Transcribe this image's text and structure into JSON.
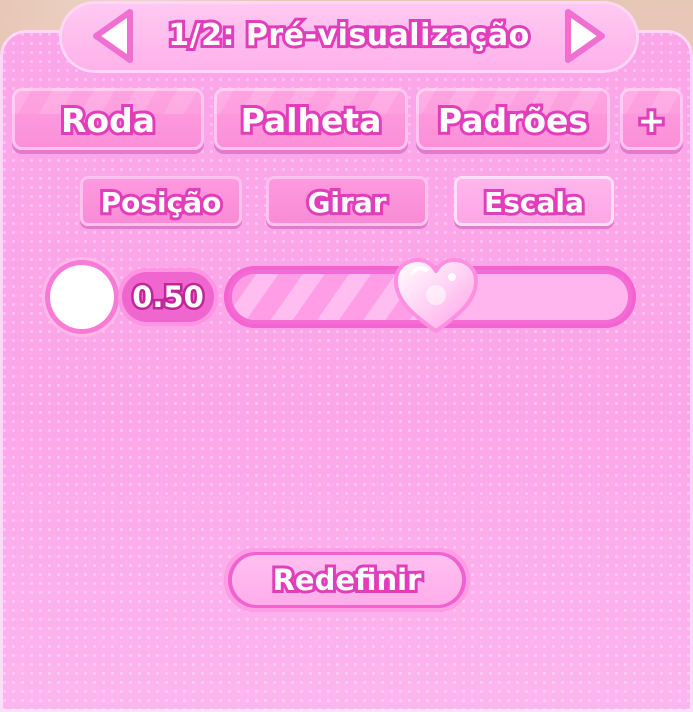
{
  "header": {
    "title": "1/2: Pré-visualização",
    "prev_icon": "triangle-left-icon",
    "next_icon": "triangle-right-icon"
  },
  "tabs": [
    {
      "label": "Roda"
    },
    {
      "label": "Palheta"
    },
    {
      "label": "Padrões"
    },
    {
      "label": "+"
    }
  ],
  "subtabs": [
    {
      "label": "Posição",
      "active": false
    },
    {
      "label": "Girar",
      "active": false
    },
    {
      "label": "Escala",
      "active": true
    }
  ],
  "slider": {
    "value_text": "0.50",
    "value": 0.5,
    "knob_icon": "heart-icon",
    "swatch_color": "#ffffff"
  },
  "reset": {
    "label": "Redefinir"
  },
  "colors": {
    "panel": "#fca6ea",
    "outline": "#e23dbb",
    "accent": "#f062cf"
  }
}
